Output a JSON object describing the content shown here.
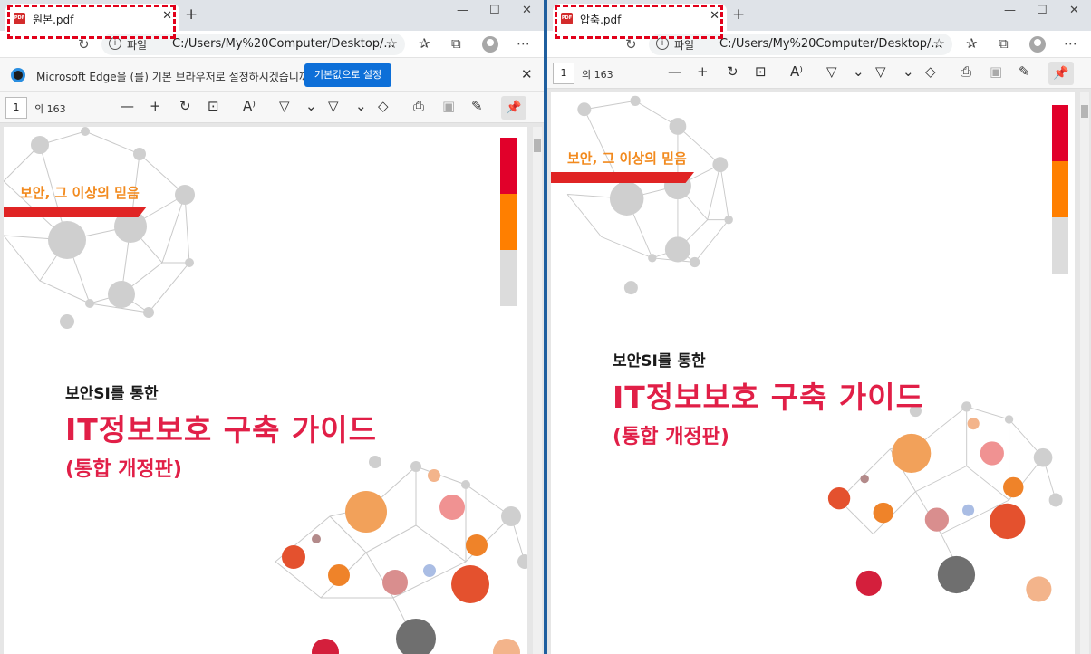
{
  "left": {
    "tab_title": "원본.pdf",
    "file_label": "파일",
    "url": "C:/Users/My%20Computer/Desktop/...",
    "infobar_text": "Microsoft Edge을 (를) 기본 브라우저로 설정하시겠습니까?",
    "infobar_button": "기본값으로 설정",
    "page_current": "1",
    "page_total": "의 163"
  },
  "right": {
    "tab_title": "압축.pdf",
    "file_label": "파일",
    "url": "C:/Users/My%20Computer/Desktop/...",
    "page_current": "1",
    "page_total": "의 163"
  },
  "document": {
    "motto": "보안, 그 이상의 믿음",
    "subtitle": "보안SI를 통한",
    "title": "IT정보보호 구축 가이드",
    "title_sub": "(통합 개정판)"
  },
  "icons": {
    "pdf": "pdf-icon",
    "close": "close-icon",
    "plus": "plus-icon",
    "minimize": "minimize-icon",
    "maximize": "maximize-icon",
    "refresh": "refresh-icon",
    "info": "info-icon",
    "favorite": "star-icon",
    "favorites": "favorites-icon",
    "collections": "collections-icon",
    "profile": "profile-icon",
    "more": "more-icon",
    "zoom_out": "zoom-out-icon",
    "zoom_in": "zoom-in-icon",
    "rotate": "rotate-icon",
    "fit": "fit-page-icon",
    "read_aloud": "read-aloud-icon",
    "draw": "draw-icon",
    "highlight": "highlight-icon",
    "erase": "eraser-icon",
    "print": "print-icon",
    "save": "save-icon",
    "save_as": "save-as-icon",
    "pin": "pin-icon"
  },
  "colors": {
    "accent_red": "#e11f47",
    "orange": "#f28a1e",
    "highlight": "#e2001a",
    "edge_blue": "#0d6fd8"
  }
}
